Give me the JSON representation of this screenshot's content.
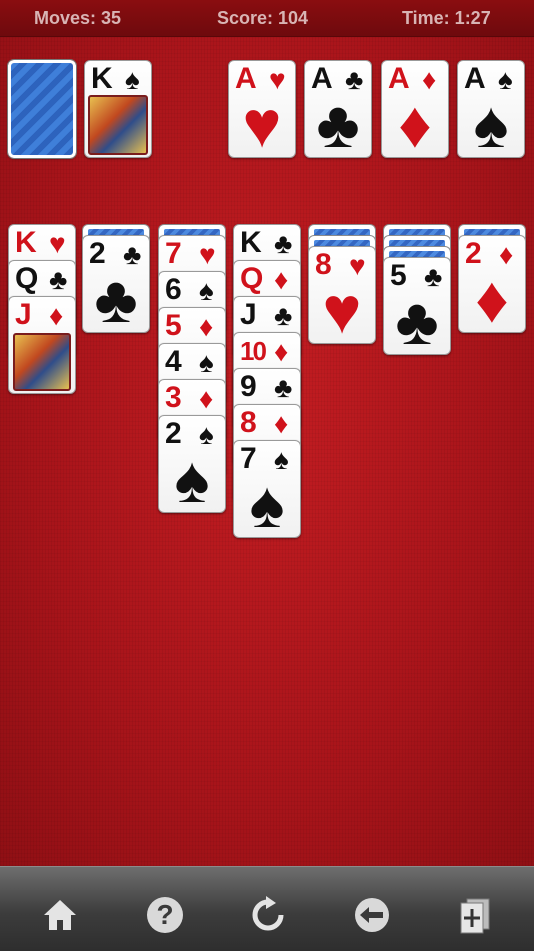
{
  "status": {
    "moves": "Moves: 35",
    "score": "Score: 104",
    "time": "Time: 1:27"
  },
  "waste": {
    "rank": "K",
    "suit": "♠"
  },
  "foundations": [
    {
      "rank": "A",
      "suit": "♥"
    },
    {
      "rank": "A",
      "suit": "♣"
    },
    {
      "rank": "A",
      "suit": "♦"
    },
    {
      "rank": "A",
      "suit": "♠"
    }
  ],
  "tableau": [
    {
      "hidden": 0,
      "cards": [
        {
          "rank": "K",
          "suit": "♥"
        },
        {
          "rank": "Q",
          "suit": "♣"
        },
        {
          "rank": "J",
          "suit": "♦"
        }
      ]
    },
    {
      "hidden": 1,
      "cards": [
        {
          "rank": "2",
          "suit": "♣"
        }
      ]
    },
    {
      "hidden": 1,
      "cards": [
        {
          "rank": "7",
          "suit": "♥"
        },
        {
          "rank": "6",
          "suit": "♠"
        },
        {
          "rank": "5",
          "suit": "♦"
        },
        {
          "rank": "4",
          "suit": "♠"
        },
        {
          "rank": "3",
          "suit": "♦"
        },
        {
          "rank": "2",
          "suit": "♠"
        }
      ]
    },
    {
      "hidden": 0,
      "cards": [
        {
          "rank": "K",
          "suit": "♣"
        },
        {
          "rank": "Q",
          "suit": "♦"
        },
        {
          "rank": "J",
          "suit": "♣"
        },
        {
          "rank": "10",
          "suit": "♦"
        },
        {
          "rank": "9",
          "suit": "♣"
        },
        {
          "rank": "8",
          "suit": "♦"
        },
        {
          "rank": "7",
          "suit": "♠"
        }
      ]
    },
    {
      "hidden": 2,
      "cards": [
        {
          "rank": "8",
          "suit": "♥"
        }
      ]
    },
    {
      "hidden": 3,
      "cards": [
        {
          "rank": "5",
          "suit": "♣"
        }
      ]
    },
    {
      "hidden": 1,
      "cards": [
        {
          "rank": "2",
          "suit": "♦"
        }
      ]
    }
  ],
  "toolbar": {
    "home": "home-icon",
    "help": "?",
    "restart": "refresh-icon",
    "undo": "undo-icon",
    "deal": "new-deal-icon"
  }
}
